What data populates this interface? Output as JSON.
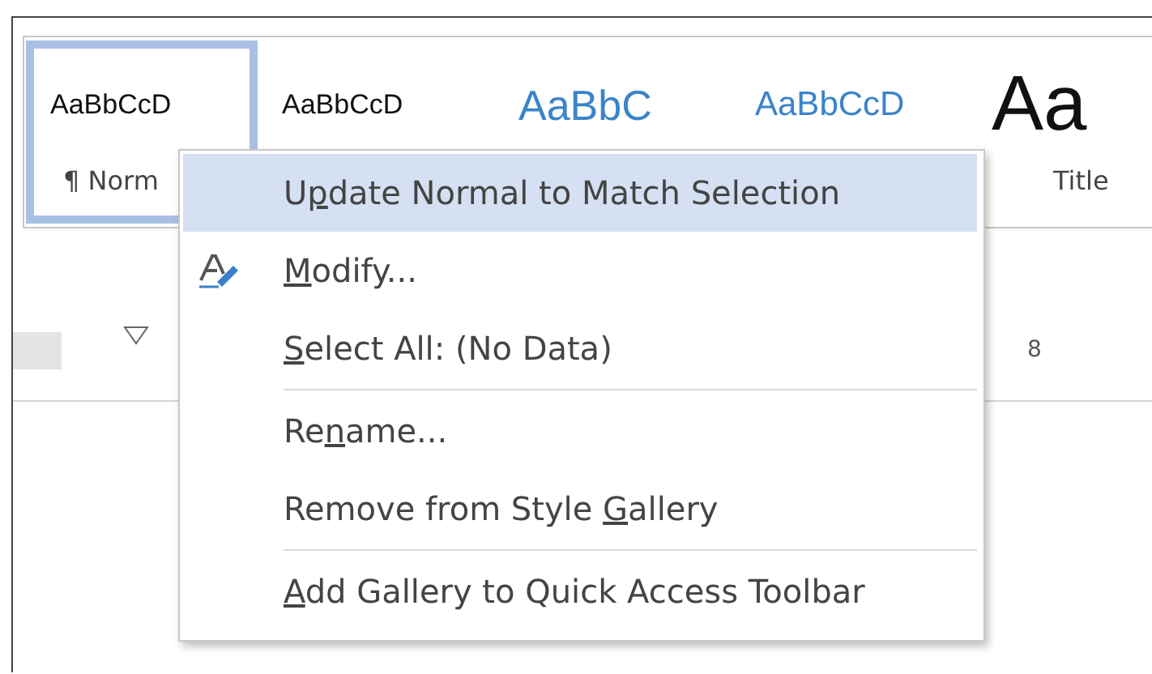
{
  "style_gallery": [
    {
      "preview": "AaBbCcD",
      "name": "¶ Norm",
      "kind": "body",
      "selected": true
    },
    {
      "preview": "AaBbCcD",
      "kind": "body",
      "selected": false
    },
    {
      "preview": "AaBbC",
      "kind": "heading1",
      "selected": false
    },
    {
      "preview": "AaBbCcD",
      "kind": "heading2",
      "selected": false
    },
    {
      "preview": "Aa",
      "name": "Title",
      "kind": "title",
      "selected": false
    }
  ],
  "ruler": {
    "label": "8"
  },
  "context_menu": [
    {
      "kind": "item",
      "label": {
        "before": "U",
        "key": "p",
        "after": "date Normal to Match Selection"
      },
      "selected": true
    },
    {
      "kind": "icon_item",
      "label": {
        "key": "M",
        "after": "odify..."
      },
      "selected": false
    },
    {
      "kind": "item",
      "label": {
        "key": "S",
        "after": "elect All: (No Data)"
      },
      "selected": false
    },
    {
      "kind": "separator"
    },
    {
      "kind": "item",
      "label": {
        "before": "Re",
        "key": "n",
        "after": "ame..."
      },
      "selected": false
    },
    {
      "kind": "item",
      "label": {
        "before": "Remove from Style ",
        "key": "G",
        "after": "allery"
      },
      "selected": false
    },
    {
      "kind": "separator"
    },
    {
      "kind": "item",
      "label": {
        "key": "A",
        "after": "dd Gallery to Quick Access Toolbar"
      },
      "selected": false
    }
  ]
}
